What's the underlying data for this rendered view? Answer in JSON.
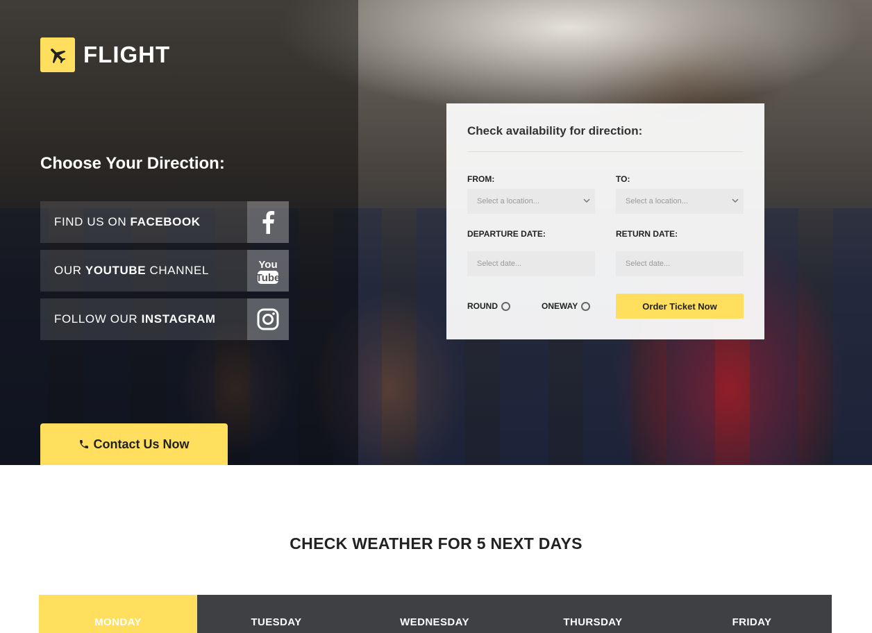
{
  "brand": {
    "name": "FLIGHT",
    "accent_color": "#ffdf5d",
    "icon": "airplane-icon"
  },
  "hero": {
    "heading": "Choose Your Direction:",
    "social": [
      {
        "prefix": "FIND US ON ",
        "bold": "FACEBOOK",
        "suffix": "",
        "icon": "facebook-icon"
      },
      {
        "prefix": "OUR ",
        "bold": "YOUTUBE",
        "suffix": " CHANNEL",
        "icon": "youtube-icon"
      },
      {
        "prefix": "FOLLOW OUR ",
        "bold": "INSTAGRAM",
        "suffix": "",
        "icon": "instagram-icon"
      }
    ],
    "contact_label": "Contact Us Now",
    "contact_icon": "phone-icon"
  },
  "booking": {
    "title": "Check availability for direction:",
    "from_label": "FROM:",
    "from_placeholder": "Select a location...",
    "to_label": "TO:",
    "to_placeholder": "Select a location...",
    "departure_label": "DEPARTURE DATE:",
    "departure_placeholder": "Select date...",
    "return_label": "RETURN DATE:",
    "return_placeholder": "Select date...",
    "round_label": "ROUND",
    "oneway_label": "ONEWAY",
    "order_label": "Order Ticket Now"
  },
  "weather": {
    "title": "CHECK WEATHER FOR 5 NEXT DAYS",
    "days": [
      "MONDAY",
      "TUESDAY",
      "WEDNESDAY",
      "THURSDAY",
      "FRIDAY"
    ],
    "active_day": "MONDAY"
  }
}
